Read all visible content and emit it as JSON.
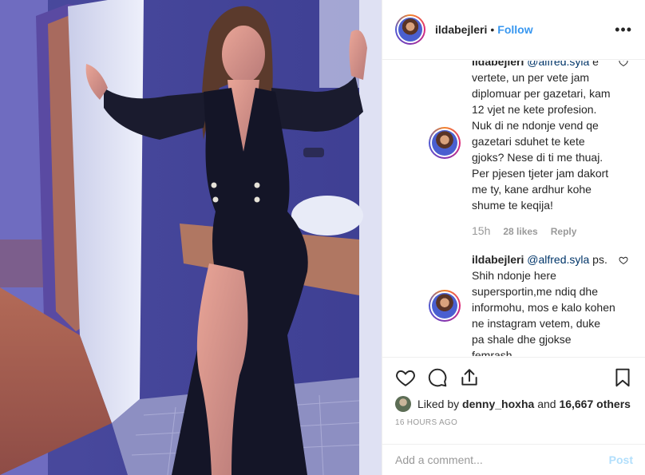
{
  "header": {
    "username": "ildabejleri",
    "separator": "•",
    "follow_label": "Follow",
    "more_label": "•••"
  },
  "comments": [
    {
      "user_hidden": "ildabejleri",
      "mention": "@alfred.syla",
      "text_first_line_tail": "e",
      "text": "vertete, un per vete jam diplomuar per gazetari, kam 12 vjet ne kete profesion. Nuk di ne ndonje vend qe gazetari sduhet te kete gjoks? Nese di ti me thuaj. Per pjesen tjeter jam dakort me ty, kane ardhur kohe shume te keqija!",
      "time": "15h",
      "likes": "28 likes",
      "reply_label": "Reply"
    },
    {
      "user": "ildabejleri",
      "mention": "@alfred.syla",
      "text": "ps. Shih ndonje here supersportin,me ndiq dhe informohu, mos e kalo kohen ne instagram vetem, duke pa shale dhe gjokse femrash."
    }
  ],
  "actions": {
    "icons": [
      "heart-icon",
      "comment-icon",
      "share-icon",
      "bookmark-icon"
    ],
    "liked_by_prefix": "Liked by",
    "liked_by_user": "denny_hoxha",
    "liked_by_and": "and",
    "liked_by_count": "16,667 others",
    "timestamp": "16 HOURS AGO"
  },
  "add_comment": {
    "placeholder": "Add a comment...",
    "post_label": "Post"
  },
  "colors": {
    "link_blue": "#3897f0",
    "mention_navy": "#003569",
    "muted": "#999999",
    "post_disabled": "#b2dffc"
  }
}
